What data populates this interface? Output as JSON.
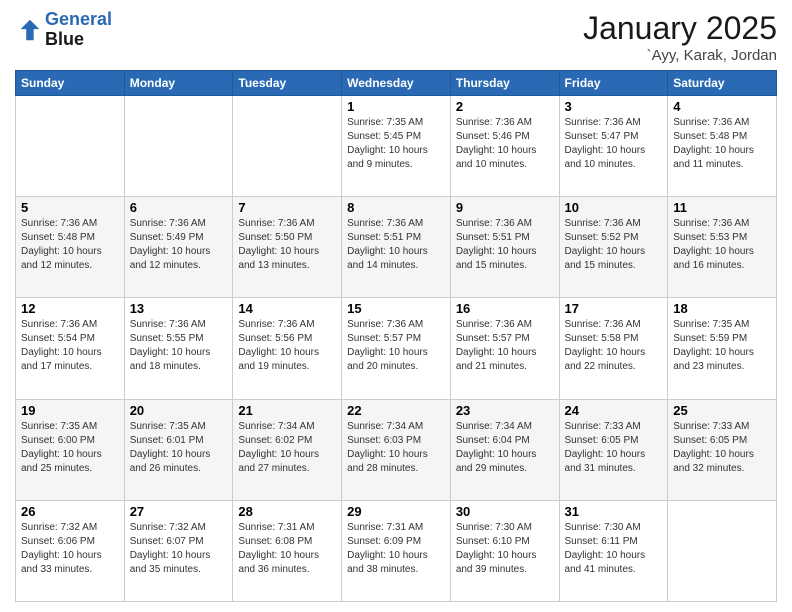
{
  "header": {
    "logo_line1": "General",
    "logo_line2": "Blue",
    "month": "January 2025",
    "location": "`Ayy, Karak, Jordan"
  },
  "days_of_week": [
    "Sunday",
    "Monday",
    "Tuesday",
    "Wednesday",
    "Thursday",
    "Friday",
    "Saturday"
  ],
  "weeks": [
    {
      "alt": false,
      "cells": [
        {
          "day": "",
          "content": ""
        },
        {
          "day": "",
          "content": ""
        },
        {
          "day": "",
          "content": ""
        },
        {
          "day": "1",
          "content": "Sunrise: 7:35 AM\nSunset: 5:45 PM\nDaylight: 10 hours\nand 9 minutes."
        },
        {
          "day": "2",
          "content": "Sunrise: 7:36 AM\nSunset: 5:46 PM\nDaylight: 10 hours\nand 10 minutes."
        },
        {
          "day": "3",
          "content": "Sunrise: 7:36 AM\nSunset: 5:47 PM\nDaylight: 10 hours\nand 10 minutes."
        },
        {
          "day": "4",
          "content": "Sunrise: 7:36 AM\nSunset: 5:48 PM\nDaylight: 10 hours\nand 11 minutes."
        }
      ]
    },
    {
      "alt": true,
      "cells": [
        {
          "day": "5",
          "content": "Sunrise: 7:36 AM\nSunset: 5:48 PM\nDaylight: 10 hours\nand 12 minutes."
        },
        {
          "day": "6",
          "content": "Sunrise: 7:36 AM\nSunset: 5:49 PM\nDaylight: 10 hours\nand 12 minutes."
        },
        {
          "day": "7",
          "content": "Sunrise: 7:36 AM\nSunset: 5:50 PM\nDaylight: 10 hours\nand 13 minutes."
        },
        {
          "day": "8",
          "content": "Sunrise: 7:36 AM\nSunset: 5:51 PM\nDaylight: 10 hours\nand 14 minutes."
        },
        {
          "day": "9",
          "content": "Sunrise: 7:36 AM\nSunset: 5:51 PM\nDaylight: 10 hours\nand 15 minutes."
        },
        {
          "day": "10",
          "content": "Sunrise: 7:36 AM\nSunset: 5:52 PM\nDaylight: 10 hours\nand 15 minutes."
        },
        {
          "day": "11",
          "content": "Sunrise: 7:36 AM\nSunset: 5:53 PM\nDaylight: 10 hours\nand 16 minutes."
        }
      ]
    },
    {
      "alt": false,
      "cells": [
        {
          "day": "12",
          "content": "Sunrise: 7:36 AM\nSunset: 5:54 PM\nDaylight: 10 hours\nand 17 minutes."
        },
        {
          "day": "13",
          "content": "Sunrise: 7:36 AM\nSunset: 5:55 PM\nDaylight: 10 hours\nand 18 minutes."
        },
        {
          "day": "14",
          "content": "Sunrise: 7:36 AM\nSunset: 5:56 PM\nDaylight: 10 hours\nand 19 minutes."
        },
        {
          "day": "15",
          "content": "Sunrise: 7:36 AM\nSunset: 5:57 PM\nDaylight: 10 hours\nand 20 minutes."
        },
        {
          "day": "16",
          "content": "Sunrise: 7:36 AM\nSunset: 5:57 PM\nDaylight: 10 hours\nand 21 minutes."
        },
        {
          "day": "17",
          "content": "Sunrise: 7:36 AM\nSunset: 5:58 PM\nDaylight: 10 hours\nand 22 minutes."
        },
        {
          "day": "18",
          "content": "Sunrise: 7:35 AM\nSunset: 5:59 PM\nDaylight: 10 hours\nand 23 minutes."
        }
      ]
    },
    {
      "alt": true,
      "cells": [
        {
          "day": "19",
          "content": "Sunrise: 7:35 AM\nSunset: 6:00 PM\nDaylight: 10 hours\nand 25 minutes."
        },
        {
          "day": "20",
          "content": "Sunrise: 7:35 AM\nSunset: 6:01 PM\nDaylight: 10 hours\nand 26 minutes."
        },
        {
          "day": "21",
          "content": "Sunrise: 7:34 AM\nSunset: 6:02 PM\nDaylight: 10 hours\nand 27 minutes."
        },
        {
          "day": "22",
          "content": "Sunrise: 7:34 AM\nSunset: 6:03 PM\nDaylight: 10 hours\nand 28 minutes."
        },
        {
          "day": "23",
          "content": "Sunrise: 7:34 AM\nSunset: 6:04 PM\nDaylight: 10 hours\nand 29 minutes."
        },
        {
          "day": "24",
          "content": "Sunrise: 7:33 AM\nSunset: 6:05 PM\nDaylight: 10 hours\nand 31 minutes."
        },
        {
          "day": "25",
          "content": "Sunrise: 7:33 AM\nSunset: 6:05 PM\nDaylight: 10 hours\nand 32 minutes."
        }
      ]
    },
    {
      "alt": false,
      "cells": [
        {
          "day": "26",
          "content": "Sunrise: 7:32 AM\nSunset: 6:06 PM\nDaylight: 10 hours\nand 33 minutes."
        },
        {
          "day": "27",
          "content": "Sunrise: 7:32 AM\nSunset: 6:07 PM\nDaylight: 10 hours\nand 35 minutes."
        },
        {
          "day": "28",
          "content": "Sunrise: 7:31 AM\nSunset: 6:08 PM\nDaylight: 10 hours\nand 36 minutes."
        },
        {
          "day": "29",
          "content": "Sunrise: 7:31 AM\nSunset: 6:09 PM\nDaylight: 10 hours\nand 38 minutes."
        },
        {
          "day": "30",
          "content": "Sunrise: 7:30 AM\nSunset: 6:10 PM\nDaylight: 10 hours\nand 39 minutes."
        },
        {
          "day": "31",
          "content": "Sunrise: 7:30 AM\nSunset: 6:11 PM\nDaylight: 10 hours\nand 41 minutes."
        },
        {
          "day": "",
          "content": ""
        }
      ]
    }
  ]
}
